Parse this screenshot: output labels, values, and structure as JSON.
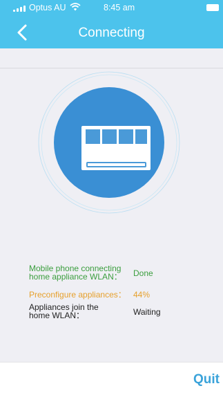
{
  "status_bar": {
    "carrier": "Optus AU",
    "time": "8:45 am",
    "icons": [
      "signal-icon",
      "wifi-icon",
      "battery-icon"
    ]
  },
  "nav": {
    "back_icon": "chevron-left-icon",
    "title": "Connecting"
  },
  "illustration": {
    "icon": "air-conditioner-icon",
    "circle_color": "#3a8fd4",
    "ring_color": "#a7d6ee"
  },
  "steps": [
    {
      "label_line1": "Mobile phone connecting",
      "label_line2": "home appliance WLAN：",
      "value": "Done",
      "color": "#3b9e3e"
    },
    {
      "label_line1": "Preconfigure appliances：",
      "label_line2": "",
      "value": "44%",
      "color": "#e6a02c"
    },
    {
      "label_line1": "Appliances join the",
      "label_line2": "home WLAN：",
      "value": "Waiting",
      "color": "#222222"
    }
  ],
  "footer": {
    "quit_label": "Quit",
    "accent": "#3aa3da"
  },
  "colors": {
    "header": "#4cc3ec",
    "background": "#efeff4"
  }
}
